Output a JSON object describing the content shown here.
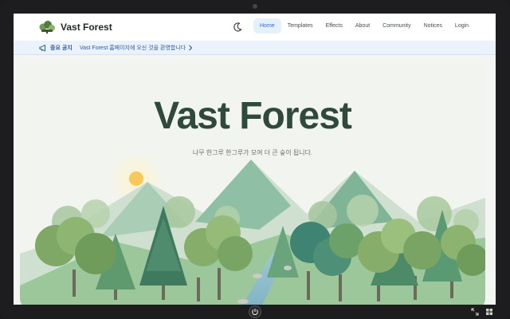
{
  "header": {
    "logo_text": "Vast Forest",
    "nav": [
      {
        "label": "Home",
        "active": true
      },
      {
        "label": "Templates",
        "active": false
      },
      {
        "label": "Effects",
        "active": false
      },
      {
        "label": "About",
        "active": false
      },
      {
        "label": "Community",
        "active": false
      },
      {
        "label": "Notices",
        "active": false
      },
      {
        "label": "Login",
        "active": false
      }
    ],
    "theme_icon": "moon-icon"
  },
  "notice": {
    "label": "중요 공지",
    "text": "Vast Forest 홈페이지에 오신 것을 환영합니다",
    "icon": "megaphone-icon"
  },
  "hero": {
    "title": "Vast Forest",
    "subtitle": "나무 한그루 한그루가 모여 더 큰 숲이 됩니다."
  },
  "colors": {
    "title": "#2f4a3d",
    "nav_active_bg": "#e6f0fb",
    "nav_active_text": "#2b6fd1",
    "notice_bg": "#eaf2fc",
    "notice_text": "#2b5aa8"
  }
}
